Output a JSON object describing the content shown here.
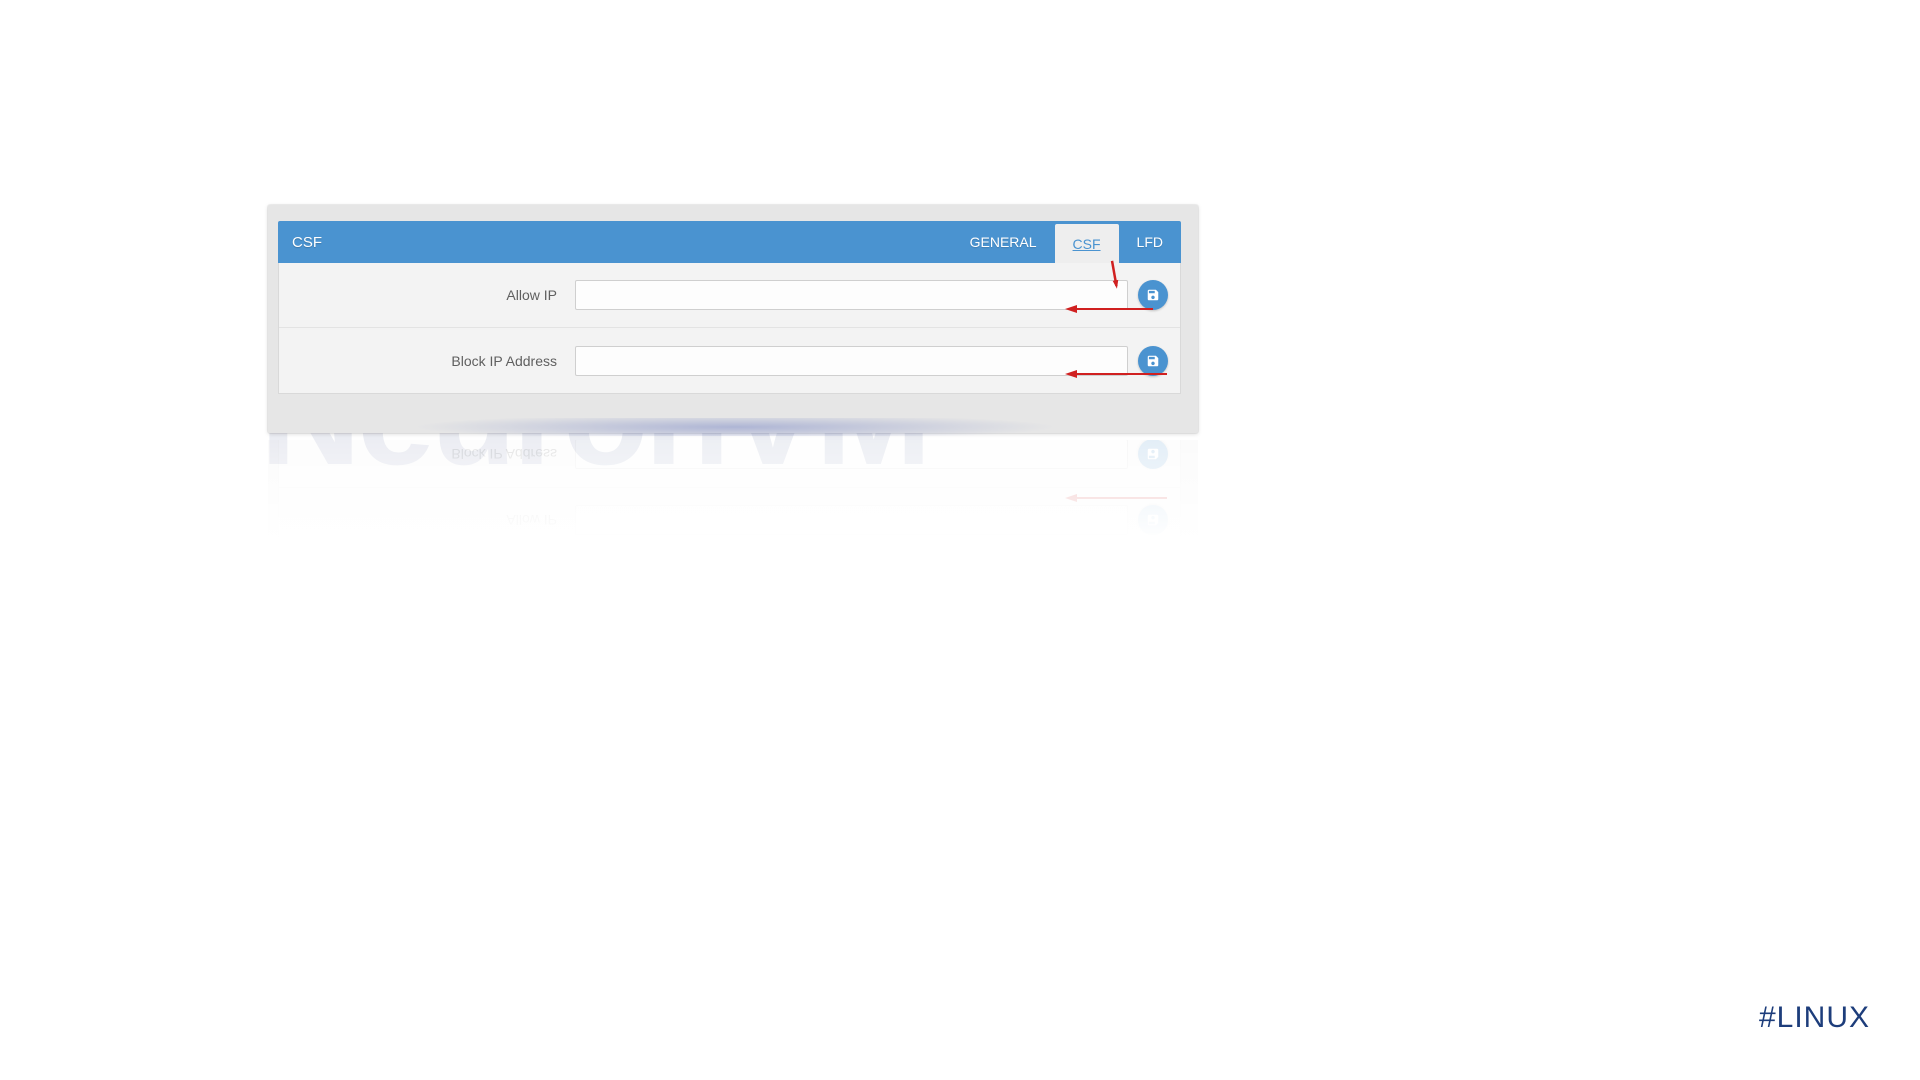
{
  "panel": {
    "title": "CSF",
    "tabs": [
      {
        "label": "GENERAL",
        "active": false
      },
      {
        "label": "CSF",
        "active": true
      },
      {
        "label": "LFD",
        "active": false
      }
    ]
  },
  "form": {
    "allow": {
      "label": "Allow IP",
      "value": ""
    },
    "block": {
      "label": "Block IP Address",
      "value": ""
    }
  },
  "watermark": "NeuronVM",
  "hashtag": "#LINUX",
  "icons": {
    "save": "save-icon"
  },
  "colors": {
    "primary": "#4a93d0",
    "arrow": "#d02020"
  }
}
